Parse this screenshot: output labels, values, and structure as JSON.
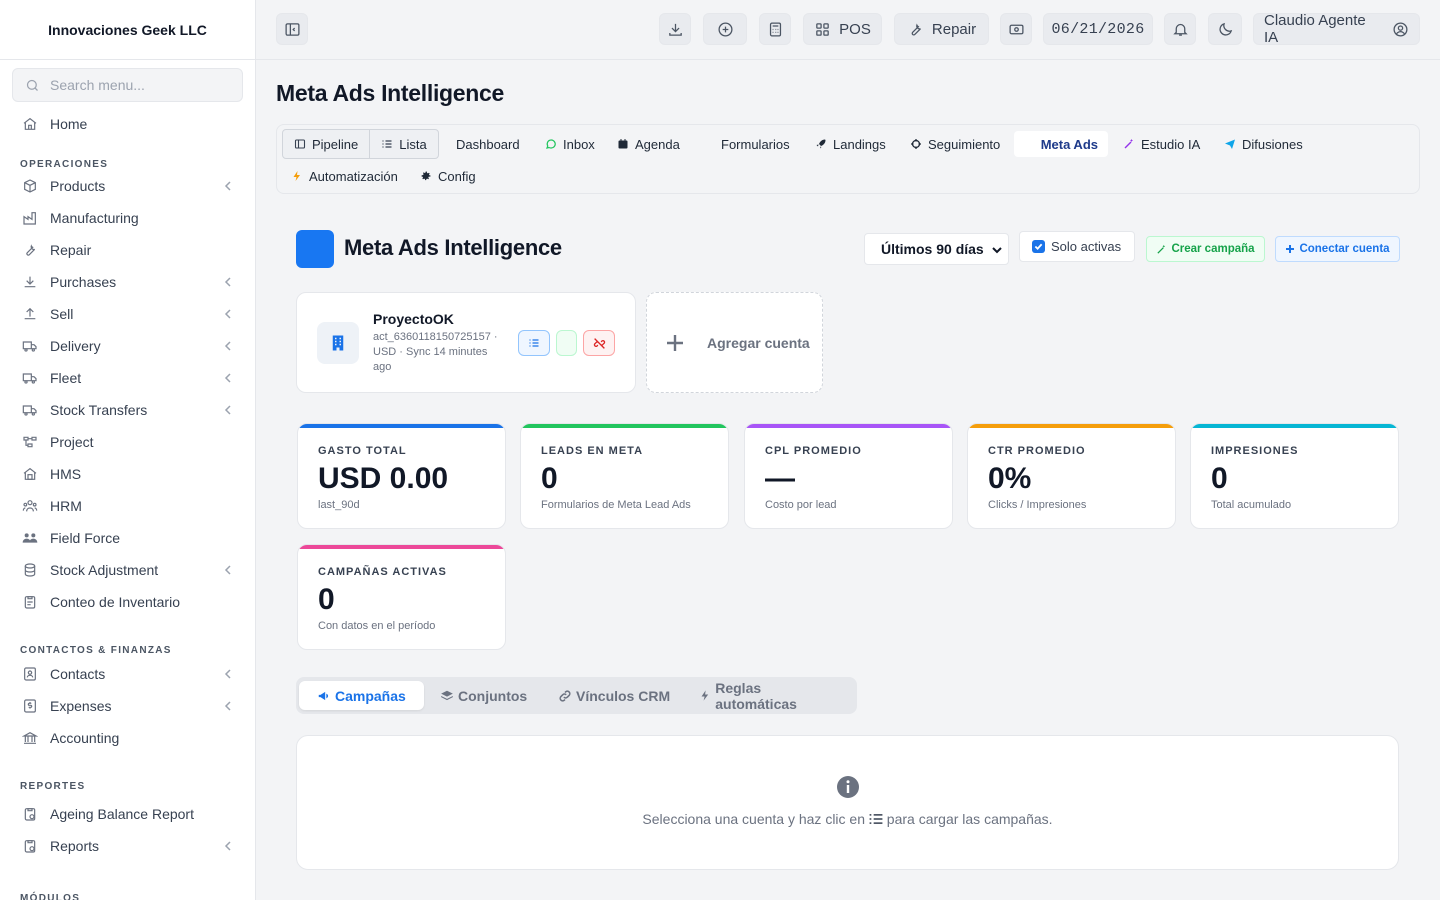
{
  "sidebar": {
    "company": "Innovaciones Geek LLC",
    "search_placeholder": "Search menu...",
    "home": "Home",
    "sections": {
      "operaciones": "OPERACIONES",
      "contactos": "CONTACTOS & FINANZAS",
      "reportes": "REPORTES",
      "modulos": "MÓDULOS"
    },
    "items": {
      "products": "Products",
      "manufacturing": "Manufacturing",
      "repair": "Repair",
      "purchases": "Purchases",
      "sell": "Sell",
      "delivery": "Delivery",
      "fleet": "Fleet",
      "stock_transfers": "Stock Transfers",
      "project": "Project",
      "hms": "HMS",
      "hrm": "HRM",
      "field_force": "Field Force",
      "stock_adjustment": "Stock Adjustment",
      "conteo": "Conteo de Inventario",
      "contacts": "Contacts",
      "expenses": "Expenses",
      "accounting": "Accounting",
      "ageing": "Ageing Balance Report",
      "reports": "Reports"
    }
  },
  "topbar": {
    "pos": "POS",
    "repair": "Repair",
    "date": "06/21/2026",
    "user": "Claudio Agente IA"
  },
  "page_title": "Meta Ads Intelligence",
  "tabs": {
    "pipeline": "Pipeline",
    "lista": "Lista",
    "dashboard": "Dashboard",
    "inbox": "Inbox",
    "agenda": "Agenda",
    "formularios": "Formularios",
    "landings": "Landings",
    "seguimiento": "Seguimiento",
    "meta_ads": "Meta Ads",
    "estudio": "Estudio IA",
    "difusiones": "Difusiones",
    "automatizacion": "Automatización",
    "config": "Config"
  },
  "meta": {
    "title": "Meta Ads Intelligence",
    "range": "Últimos 90 días",
    "solo_activas": "Solo activas",
    "solo_activas_checked": true,
    "crear": "Crear campaña",
    "conectar": "Conectar cuenta",
    "account": {
      "name": "ProyectoOK",
      "meta": "act_6360118150725157 · USD · Sync 14 minutes ago"
    },
    "add_account": "Agregar cuenta"
  },
  "kpis": [
    {
      "label": "GASTO TOTAL",
      "value": "USD 0.00",
      "sub": "last_90d",
      "color": "#1a73e8"
    },
    {
      "label": "LEADS EN META",
      "value": "0",
      "sub": "Formularios de Meta Lead Ads",
      "color": "#22c55e"
    },
    {
      "label": "CPL PROMEDIO",
      "value": "—",
      "sub": "Costo por lead",
      "color": "#a855f7"
    },
    {
      "label": "CTR PROMEDIO",
      "value": "0%",
      "sub": "Clicks / Impresiones",
      "color": "#f59e0b"
    },
    {
      "label": "IMPRESIONES",
      "value": "0",
      "sub": "Total acumulado",
      "color": "#06b6d4"
    },
    {
      "label": "CAMPAÑAS ACTIVAS",
      "value": "0",
      "sub": "Con datos en el período",
      "color": "#ec4899"
    }
  ],
  "subtabs": {
    "campanas": "Campañas",
    "conjuntos": "Conjuntos",
    "vinculos": "Vínculos CRM",
    "reglas": "Reglas automáticas"
  },
  "empty": {
    "before": "Selecciona una cuenta y haz clic en",
    "after": "para cargar las campañas."
  }
}
